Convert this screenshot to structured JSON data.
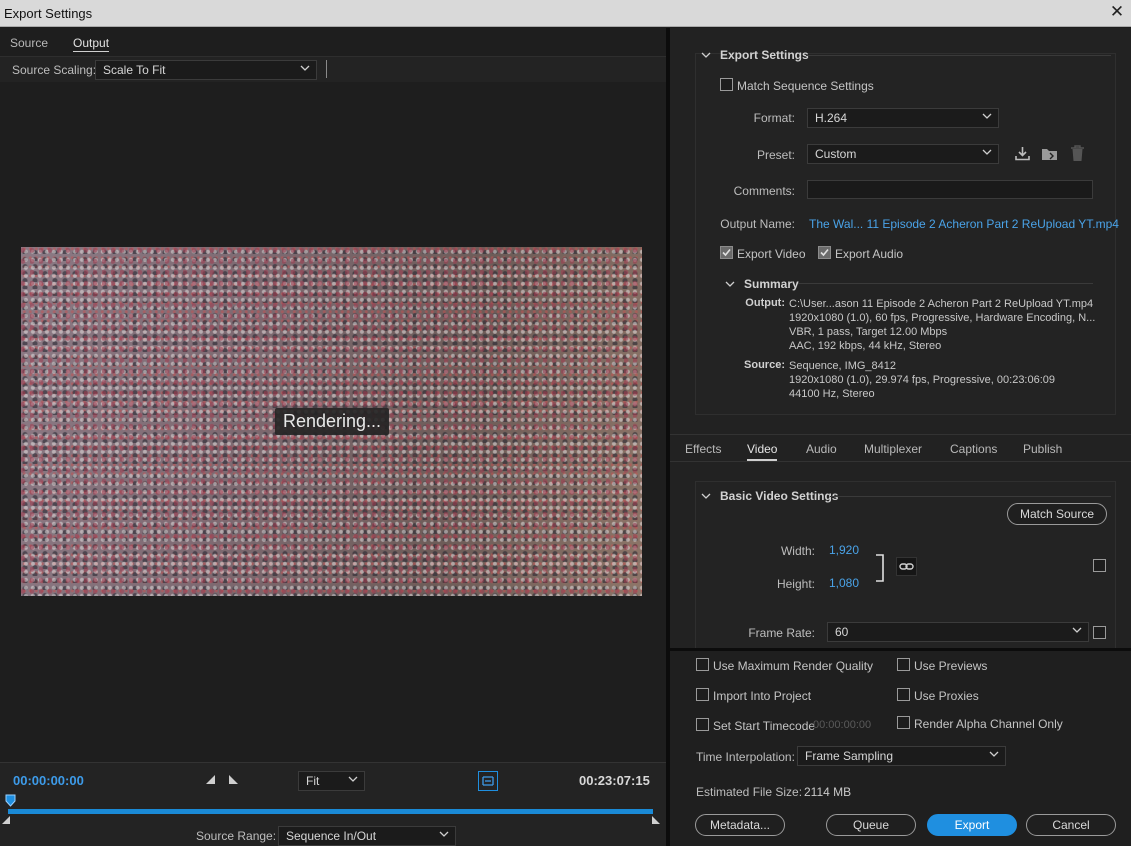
{
  "window": {
    "title": "Export Settings"
  },
  "left": {
    "tabs": [
      {
        "label": "Source"
      },
      {
        "label": "Output"
      }
    ],
    "source_scaling": {
      "label": "Source Scaling:",
      "value": "Scale To Fit"
    },
    "preview": {
      "status": "Rendering..."
    },
    "timecode_start": "00:00:00:00",
    "timecode_end": "00:23:07:15",
    "zoom": {
      "value": "Fit"
    },
    "source_range": {
      "label": "Source Range:",
      "value": "Sequence In/Out"
    }
  },
  "export_settings": {
    "header": "Export Settings",
    "match_sequence": {
      "label": "Match Sequence Settings",
      "checked": false
    },
    "format": {
      "label": "Format:",
      "value": "H.264"
    },
    "preset": {
      "label": "Preset:",
      "value": "Custom"
    },
    "comments": {
      "label": "Comments:",
      "value": ""
    },
    "output_name": {
      "label": "Output Name:",
      "value": "The Wal... 11 Episode 2 Acheron Part 2 ReUpload YT.mp4"
    },
    "export_video": {
      "label": "Export Video",
      "checked": true
    },
    "export_audio": {
      "label": "Export Audio",
      "checked": true
    },
    "summary": {
      "header": "Summary",
      "output_label": "Output:",
      "output_lines": [
        "C:\\User...ason 11 Episode 2 Acheron Part 2 ReUpload YT.mp4",
        "1920x1080 (1.0), 60 fps, Progressive, Hardware Encoding, N...",
        "VBR, 1 pass, Target 12.00 Mbps",
        "AAC, 192 kbps, 44 kHz, Stereo"
      ],
      "source_label": "Source:",
      "source_lines": [
        "Sequence, IMG_8412",
        "1920x1080 (1.0), 29.974 fps, Progressive, 00:23:06:09",
        "44100 Hz, Stereo"
      ]
    }
  },
  "settings_tabs": [
    {
      "label": "Effects"
    },
    {
      "label": "Video",
      "active": true
    },
    {
      "label": "Audio"
    },
    {
      "label": "Multiplexer"
    },
    {
      "label": "Captions"
    },
    {
      "label": "Publish"
    }
  ],
  "video": {
    "header": "Basic Video Settings",
    "match_source_label": "Match Source",
    "width": {
      "label": "Width:",
      "value": "1,920"
    },
    "height": {
      "label": "Height:",
      "value": "1,080"
    },
    "frame_rate": {
      "label": "Frame Rate:",
      "value": "60"
    }
  },
  "options": {
    "max_render_quality": {
      "label": "Use Maximum Render Quality",
      "checked": false
    },
    "use_previews": {
      "label": "Use Previews",
      "checked": false
    },
    "import_into_project": {
      "label": "Import Into Project",
      "checked": false
    },
    "use_proxies": {
      "label": "Use Proxies",
      "checked": false
    },
    "set_start_timecode": {
      "label": "Set Start Timecode",
      "checked": false,
      "value": "00:00:00:00"
    },
    "render_alpha": {
      "label": "Render Alpha Channel Only",
      "checked": false
    },
    "time_interpolation": {
      "label": "Time Interpolation:",
      "value": "Frame Sampling"
    },
    "estimated_size": {
      "label": "Estimated File Size:",
      "value": "2114 MB"
    }
  },
  "buttons": {
    "metadata": "Metadata...",
    "queue": "Queue",
    "export": "Export",
    "cancel": "Cancel"
  },
  "colors": {
    "accent": "#1f8fe0",
    "link": "#4aa3e8",
    "timecode": "#3d9be9"
  },
  "icons": [
    "close-icon",
    "chevron-down-icon",
    "save-preset-icon",
    "import-preset-icon",
    "delete-preset-icon",
    "link-icon",
    "play-in-icon",
    "play-out-icon",
    "fit-frame-icon"
  ]
}
